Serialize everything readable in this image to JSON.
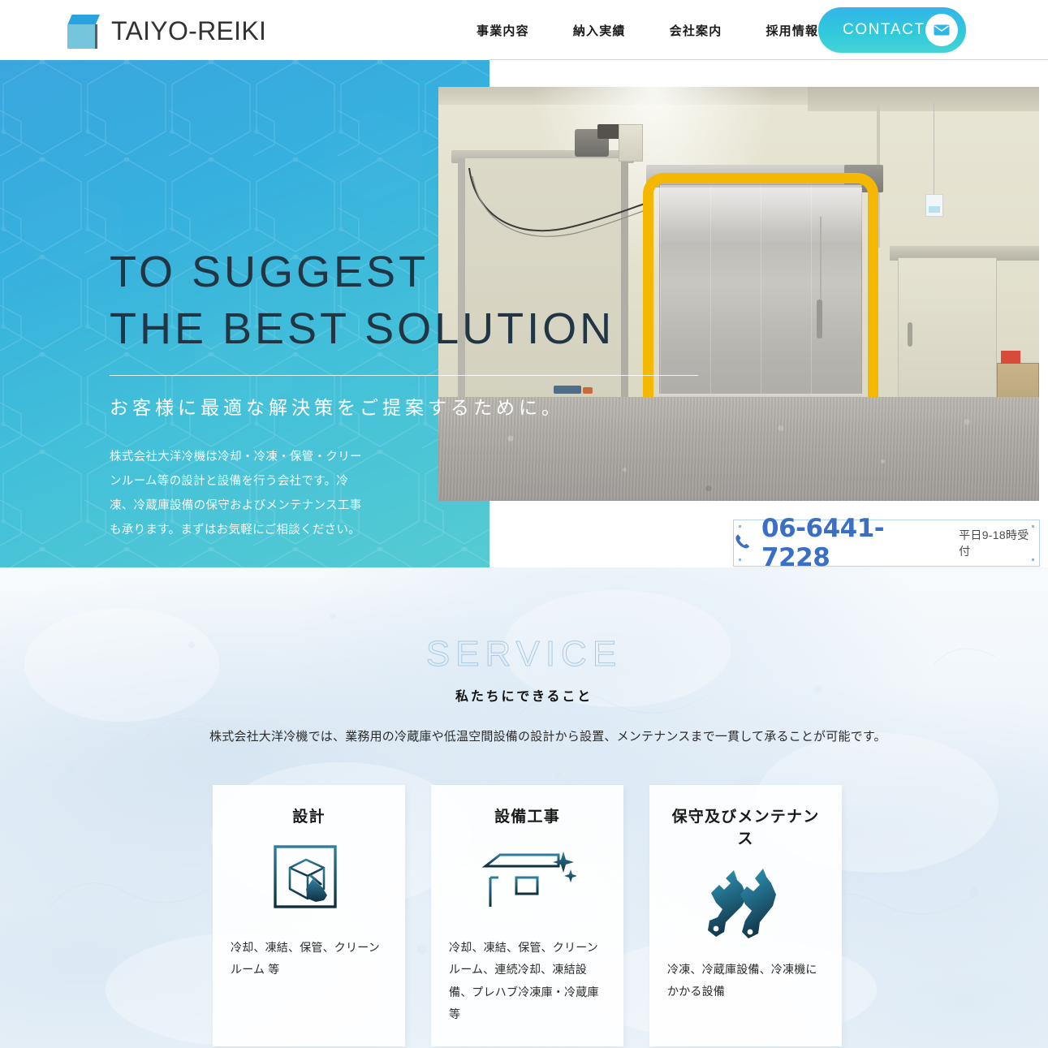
{
  "header": {
    "logo_text": "TAIYO-REIKI",
    "logo_icon": "cube-logo-icon",
    "nav": [
      {
        "label": "事業内容"
      },
      {
        "label": "納入実績"
      },
      {
        "label": "会社案内"
      },
      {
        "label": "採用情報"
      }
    ],
    "contact_button": {
      "label": "CONTACT",
      "icon": "mail-icon"
    }
  },
  "hero": {
    "title": "TO SUGGEST\nTHE BEST SOLUTION",
    "subtitle": "お客様に最適な解決策をご提案するために。",
    "description": "株式会社大洋冷機は冷却・冷凍・保管・クリーンルーム等の設計と設備を行う会社です。冷凍、冷蔵庫設備の保守およびメンテナンス工事も承ります。まずはお気軽にご相談ください。",
    "image_alt": "冷凍冷蔵倉庫のステンレス製スライドドアと黄色い防護ポール"
  },
  "phone": {
    "icon": "phone-icon",
    "number": "06-6441-7228",
    "hours": "平日9-18時受付"
  },
  "service": {
    "heading_en": "SERVICE",
    "heading_jp": "私たちにできること",
    "lead": "株式会社大洋冷機では、業務用の冷蔵庫や低温空間設備の設計から設置、メンテナンスまで一貫して承ることが可能です。",
    "cards": [
      {
        "title": "設計",
        "icon": "design-cube-hand-icon",
        "description": "冷却、凍結、保管、クリーンルーム 等"
      },
      {
        "title": "設備工事",
        "icon": "warehouse-sparkle-icon",
        "description": "冷却、凍結、保管、クリーンルーム、連続冷却、凍結設備、プレハブ冷凍庫・冷蔵庫 等"
      },
      {
        "title": "保守及びメンテナンス",
        "icon": "wrenches-icon",
        "description": "冷凍、冷蔵庫設備、冷凍機にかかる設備"
      }
    ]
  },
  "colors": {
    "brand_blue": "#2aa2e0",
    "brand_cyan": "#75c6dd",
    "hero_gradient_start": "#3aa6de",
    "hero_gradient_end": "#55cbd2",
    "hero_title": "#223545",
    "phone_blue": "#3a6fc4",
    "icon_dark": "#13384d",
    "service_en_outline": "#9fc4e2"
  }
}
